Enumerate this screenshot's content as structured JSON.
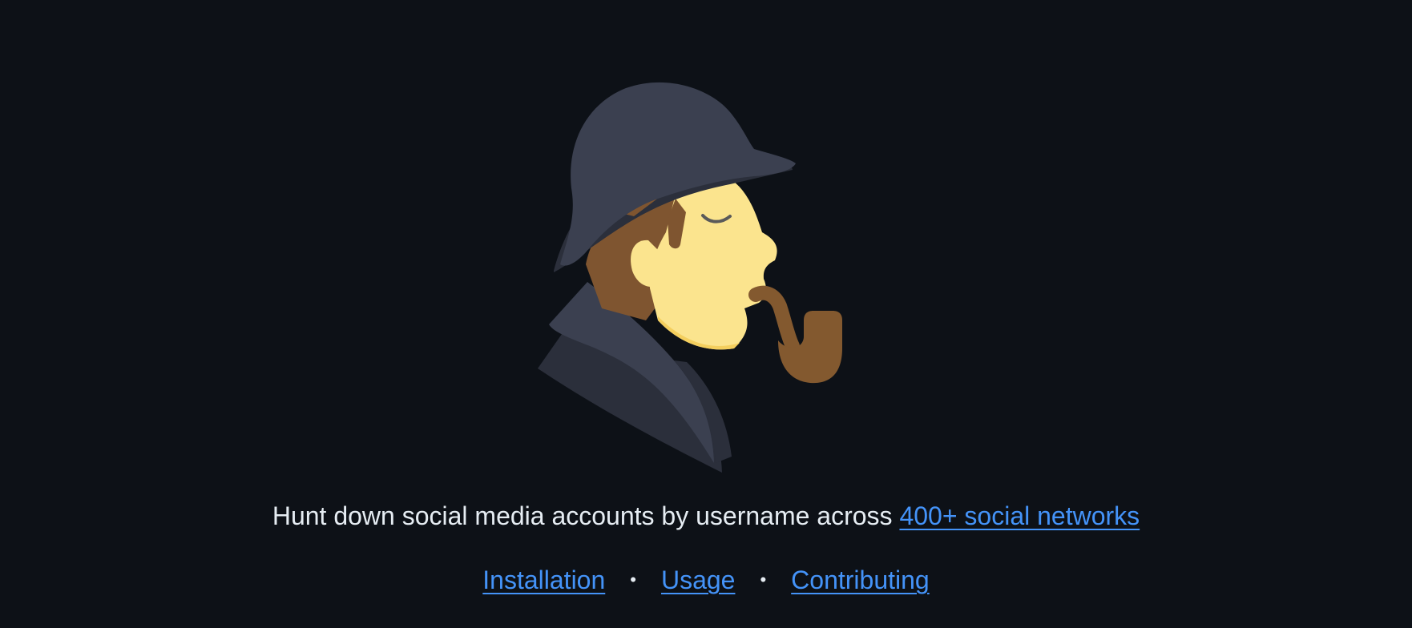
{
  "logo": {
    "icon": "detective-with-pipe-icon",
    "colors": {
      "background": "#0d1117",
      "hat": "#3b4050",
      "hat_shadow": "#2b2f3b",
      "coat": "#3b4050",
      "face": "#fbe48e",
      "face_shadow": "#f4cf5e",
      "hair": "#7f5530",
      "pipe": "#83592f",
      "eye": "#5a5a5a"
    }
  },
  "tagline": {
    "text": "Hunt down social media accounts by username across ",
    "link_label": "400+ social networks"
  },
  "nav": {
    "items": [
      {
        "label": "Installation"
      },
      {
        "label": "Usage"
      },
      {
        "label": "Contributing"
      }
    ],
    "separator": "•"
  },
  "theme": {
    "text_color": "#e6edf3",
    "link_color": "#4493f8"
  }
}
